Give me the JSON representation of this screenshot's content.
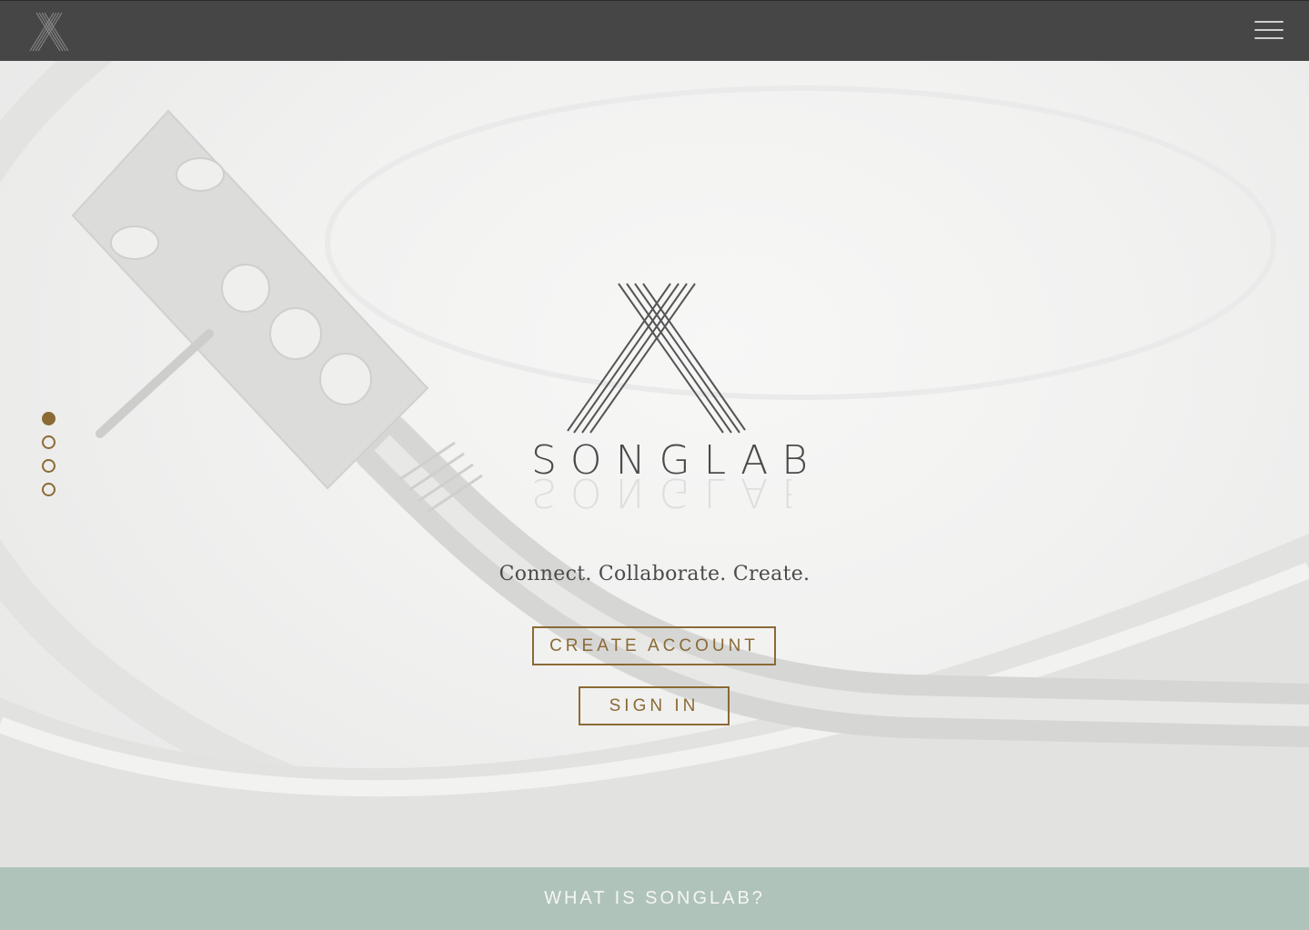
{
  "nav": {
    "logo_icon": "songlab-x-logo-icon",
    "menu_icon": "hamburger-menu-icon"
  },
  "hero": {
    "brand_name": "SONGLAB",
    "tagline": "Connect. Collaborate. Create.",
    "create_account_label": "CREATE ACCOUNT",
    "sign_in_label": "SIGN IN",
    "slides": {
      "count": 4,
      "active_index": 0
    },
    "background_image": "turntable-tonearm-photo"
  },
  "footer": {
    "what_is_label": "WHAT IS SONGLAB?"
  },
  "colors": {
    "accent": "#8b6a35",
    "nav_bg": "#464646",
    "footer_bg": "#b0c3bb"
  }
}
